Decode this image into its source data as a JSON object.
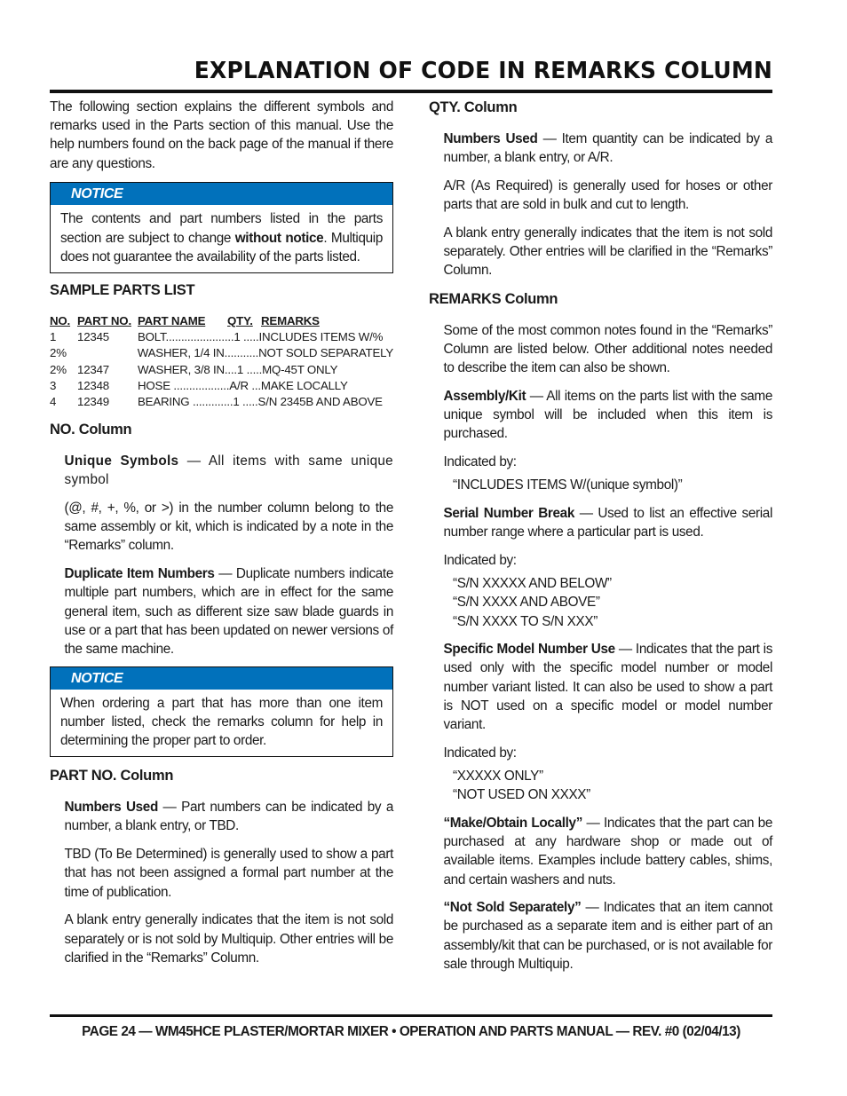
{
  "page_title": "EXPLANATION OF CODE IN REMARKS COLUMN",
  "intro": "The following section explains the different symbols and remarks used in the Parts section of this manual. Use the help numbers found on the back page of the manual if there are any questions.",
  "notice1": {
    "label": "NOTICE",
    "text_before": "The contents and part numbers listed in the parts section are subject to change ",
    "text_bold": "without notice",
    "text_after": ". Multiquip does not guarantee the availability of the parts listed."
  },
  "sample_parts_list": {
    "heading": "SAMPLE PARTS LIST",
    "columns": [
      "NO.",
      "PART NO.",
      "PART NAME",
      "QTY.",
      "REMARKS"
    ],
    "rows": [
      {
        "no": "1",
        "part_no": "12345",
        "name_qty": "BOLT......................1 .....",
        "remarks": "INCLUDES ITEMS W/%"
      },
      {
        "no": "2%",
        "part_no": "",
        "name_qty": "WASHER, 1/4 IN...........",
        "remarks": "NOT SOLD SEPARATELY"
      },
      {
        "no": "2%",
        "part_no": "12347",
        "name_qty": "WASHER, 3/8 IN....1 .....",
        "remarks": "MQ-45T ONLY"
      },
      {
        "no": "3",
        "part_no": "12348",
        "name_qty": "HOSE ..................A/R ...",
        "remarks": "MAKE LOCALLY"
      },
      {
        "no": "4",
        "part_no": "12349",
        "name_qty": "BEARING .............1 .....",
        "remarks": "S/N 2345B AND ABOVE"
      }
    ]
  },
  "no_column": {
    "heading": "NO. Column",
    "unique_symbols_bold": "Unique Symbols",
    "unique_symbols_text": " — All items with same unique symbol",
    "symbols_text": "(@, #, +, %, or >) in the number column belong to the same assembly or kit, which is indicated by a note in the “Remarks” column.",
    "duplicate_bold": "Duplicate Item Numbers",
    "duplicate_text": " — Duplicate numbers indicate multiple part numbers, which are in effect for the same general item, such as different size saw blade guards in use or a part that has been updated on newer versions of the same machine."
  },
  "notice2": {
    "label": "NOTICE",
    "text": "When ordering a part that has more than one item number listed, check the remarks column for help in determining the proper part to order."
  },
  "part_no_column": {
    "heading": "PART NO. Column",
    "numbers_used_bold": "Numbers Used",
    "numbers_used_text": " — Part numbers can be indicated by a number, a blank entry, or TBD.",
    "tbd_text": "TBD (To Be Determined) is generally used to show a part that has not been assigned a formal part number at the time of publication.",
    "blank_text": "A blank entry generally indicates that the item is not sold separately or is not sold by Multiquip. Other entries will be clarified in the “Remarks” Column."
  },
  "qty_column": {
    "heading": "QTY. Column",
    "numbers_used_bold": "Numbers Used",
    "numbers_used_text": " — Item quantity can be indicated by a number, a blank entry, or A/R.",
    "ar_text": "A/R (As Required) is generally used for hoses or other parts that are sold in bulk and cut to length.",
    "blank_text": "A blank entry generally indicates that the item is not sold separately. Other entries will be clarified in the “Remarks” Column."
  },
  "remarks_column": {
    "heading": "REMARKS Column",
    "intro": "Some of the most common notes found in the “Remarks” Column are listed below. Other additional notes needed to describe the item can also be shown.",
    "assembly_bold": "Assembly/Kit",
    "assembly_text": " — All items on the parts list with the same unique symbol will be included when this item is purchased.",
    "indicated_by": "Indicated by:",
    "assembly_quotes": [
      "“INCLUDES ITEMS W/(unique symbol)”"
    ],
    "serial_bold": "Serial Number Break",
    "serial_text": " — Used to list an effective serial number range where a particular part is used.",
    "serial_quotes": [
      "“S/N XXXXX AND BELOW”",
      "“S/N XXXX AND ABOVE”",
      "“S/N XXXX TO S/N XXX”"
    ],
    "model_bold": "Specific Model Number Use",
    "model_text": " — Indicates that the part is used only with the specific model number or model number variant listed. It can also be used to show a part is NOT used on a specific model or model number variant.",
    "model_quotes": [
      "“XXXXX ONLY”",
      "“NOT USED ON XXXX”"
    ],
    "make_bold": "“Make/Obtain Locally”",
    "make_text": " — Indicates that the part can be purchased at any hardware shop or made out of available items. Examples include battery cables, shims, and certain washers and nuts.",
    "nss_bold": "“Not Sold Separately”",
    "nss_text": " — Indicates that an item cannot be purchased as a separate item and is either part of an assembly/kit that can be purchased, or is not available for sale through Multiquip."
  },
  "footer": "PAGE 24 — WM45HCE PLASTER/MORTAR MIXER • OPERATION AND PARTS MANUAL — REV. #0 (02/04/13)",
  "colors": {
    "notice_header": "#0171bb",
    "text": "#1a1a1a"
  }
}
